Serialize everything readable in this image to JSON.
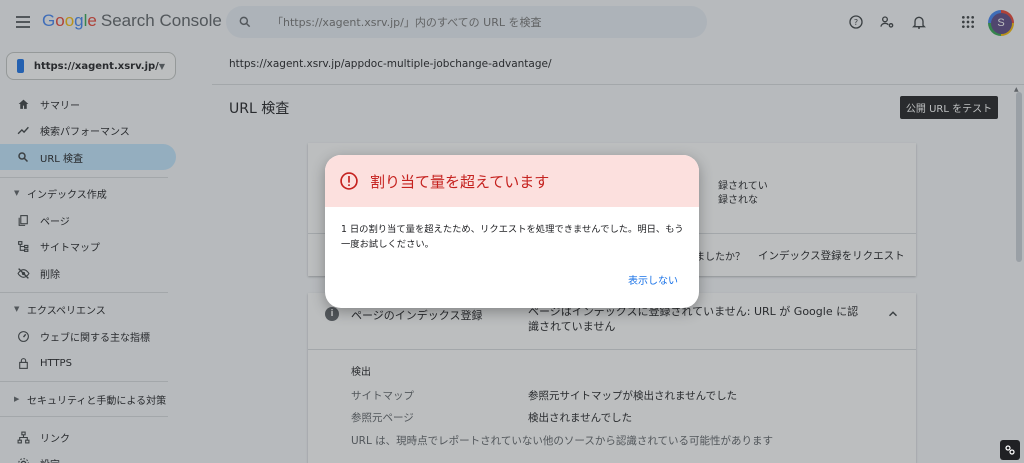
{
  "app": {
    "logo": {
      "g": "G",
      "o1": "o",
      "o2": "o",
      "g2": "g",
      "l": "l",
      "e": "e",
      "suffix": "Search Console"
    },
    "search_placeholder": "「https://xagent.xsrv.jp/」内のすべての URL を検査",
    "avatar_letter": "S"
  },
  "sidebar": {
    "property": "https://xagent.xsrv.jp/",
    "items_top": [
      {
        "label": "サマリー",
        "icon": "home-icon"
      },
      {
        "label": "検索パフォーマンス",
        "icon": "trending-up-icon"
      },
      {
        "label": "URL 検査",
        "icon": "search-icon",
        "active": true
      }
    ],
    "section_index": "インデックス作成",
    "items_index": [
      {
        "label": "ページ",
        "icon": "pages-icon"
      },
      {
        "label": "サイトマップ",
        "icon": "sitemap-icon"
      },
      {
        "label": "削除",
        "icon": "removal-icon"
      }
    ],
    "section_experience": "エクスペリエンス",
    "items_experience": [
      {
        "label": "ウェブに関する主な指標",
        "icon": "gauge-icon"
      },
      {
        "label": "HTTPS",
        "icon": "lock-icon"
      }
    ],
    "section_security": "セキュリティと手動による対策",
    "items_bottom": [
      {
        "label": "リンク",
        "icon": "links-icon"
      },
      {
        "label": "設定",
        "icon": "settings-icon"
      }
    ]
  },
  "main": {
    "inspected_url": "https://xagent.xsrv.jp/appdoc-multiple-jobchange-advantage/",
    "title": "URL 検査",
    "test_button": "公開 URL をテスト",
    "card1": {
      "partial_text_1": "録されてい",
      "partial_text_2": "録されな",
      "partial_question": "ましたか？",
      "request_index": "インデックス登録をリクエスト"
    },
    "card2": {
      "title": "ページのインデックス登録",
      "status": "ページはインデックスに登録されていません: URL が Google に認識されていません",
      "section": "検出",
      "rows": [
        {
          "label": "サイトマップ",
          "value": "参照元サイトマップが検出されませんでした"
        },
        {
          "label": "参照元ページ",
          "value": "検出されませんでした"
        }
      ],
      "note": "URL は、現時点でレポートされていない他のソースから認識されている可能性があります"
    }
  },
  "dialog": {
    "title": "割り当て量を超えています",
    "body": "1 日の割り当て量を超えたため、リクエストを処理できませんでした。明日、もう一度お試しください。",
    "dismiss": "表示しない"
  },
  "colors": {
    "accent": "#1a73e8",
    "error": "#c5221f",
    "dialog_header": "#fce0de",
    "active_nav": "#c2e7ff"
  }
}
